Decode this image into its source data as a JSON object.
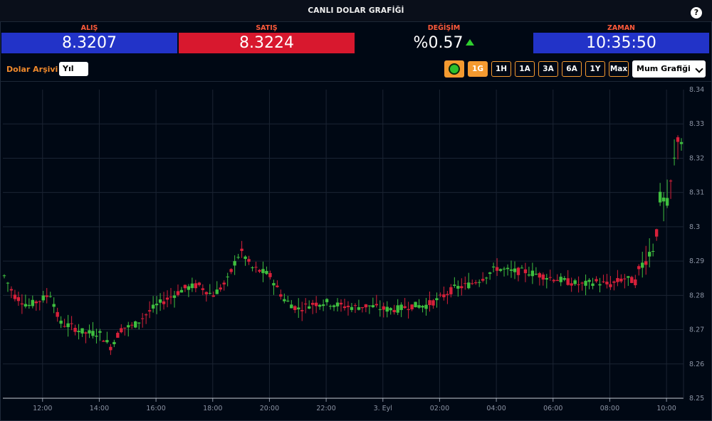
{
  "header": {
    "title": "CANLI DOLAR GRAFİĞİ",
    "help": "?"
  },
  "quotes": {
    "buy": {
      "label": "ALIŞ",
      "value": "8.3207",
      "label_color": "#ff5a3a",
      "bg": "#2233c8"
    },
    "sell": {
      "label": "SATIŞ",
      "value": "8.3224",
      "label_color": "#ff5a3a",
      "bg": "#d8182e"
    },
    "change": {
      "label": "DEĞİŞİM",
      "value": "%0.57",
      "label_color": "#ff5a3a",
      "direction": "up"
    },
    "time": {
      "label": "ZAMAN",
      "value": "10:35:50",
      "label_color": "#ff5a3a",
      "bg": "#2233c8"
    }
  },
  "toolbar": {
    "archive_label": "Dolar Arşivi",
    "period": "Yıl",
    "ranges": [
      "1G",
      "1H",
      "1A",
      "3A",
      "6A",
      "1Y",
      "Max"
    ],
    "active_range": "1G",
    "chart_type": "Mum Grafiği",
    "accent": "#f59a30"
  },
  "chart_data": {
    "type": "candlestick",
    "x_ticks": [
      "12:00",
      "14:00",
      "16:00",
      "18:00",
      "20:00",
      "22:00",
      "3. Eyl",
      "02:00",
      "04:00",
      "06:00",
      "08:00",
      "10:00"
    ],
    "y_ticks": [
      "8.34",
      "8.33",
      "8.32",
      "8.31",
      "8.3",
      "8.29",
      "8.28",
      "8.27",
      "8.26",
      "8.25"
    ],
    "ylim": [
      8.25,
      8.34
    ],
    "xlim_hours": [
      10.6,
      34.6
    ],
    "grid": true,
    "up_color": "#3fbf3f",
    "down_color": "#d8203a",
    "price_path": [
      [
        10.6,
        8.2865
      ],
      [
        11.0,
        8.28
      ],
      [
        11.5,
        8.277
      ],
      [
        12.0,
        8.279
      ],
      [
        12.3,
        8.2805
      ],
      [
        12.6,
        8.272
      ],
      [
        13.0,
        8.271
      ],
      [
        13.5,
        8.269
      ],
      [
        14.0,
        8.269
      ],
      [
        14.4,
        8.265
      ],
      [
        14.8,
        8.2705
      ],
      [
        15.2,
        8.271
      ],
      [
        15.6,
        8.274
      ],
      [
        16.0,
        8.277
      ],
      [
        16.5,
        8.2795
      ],
      [
        17.0,
        8.282
      ],
      [
        17.5,
        8.283
      ],
      [
        18.0,
        8.28
      ],
      [
        18.5,
        8.284
      ],
      [
        18.8,
        8.29
      ],
      [
        19.0,
        8.293
      ],
      [
        19.4,
        8.288
      ],
      [
        20.0,
        8.286
      ],
      [
        20.5,
        8.279
      ],
      [
        21.0,
        8.276
      ],
      [
        21.5,
        8.2775
      ],
      [
        22.0,
        8.278
      ],
      [
        22.5,
        8.277
      ],
      [
        23.0,
        8.2765
      ],
      [
        23.5,
        8.277
      ],
      [
        24.0,
        8.276
      ],
      [
        24.5,
        8.276
      ],
      [
        25.0,
        8.277
      ],
      [
        25.5,
        8.277
      ],
      [
        26.0,
        8.279
      ],
      [
        26.5,
        8.282
      ],
      [
        27.0,
        8.283
      ],
      [
        27.5,
        8.285
      ],
      [
        28.0,
        8.288
      ],
      [
        28.5,
        8.287
      ],
      [
        29.0,
        8.287
      ],
      [
        29.5,
        8.286
      ],
      [
        30.0,
        8.285
      ],
      [
        30.5,
        8.284
      ],
      [
        31.0,
        8.283
      ],
      [
        31.5,
        8.284
      ],
      [
        32.0,
        8.283
      ],
      [
        32.5,
        8.285
      ],
      [
        32.9,
        8.284
      ],
      [
        33.2,
        8.29
      ],
      [
        33.6,
        8.295
      ],
      [
        33.8,
        8.31
      ],
      [
        34.0,
        8.305
      ],
      [
        34.2,
        8.315
      ],
      [
        34.4,
        8.326
      ],
      [
        34.6,
        8.325
      ]
    ]
  }
}
